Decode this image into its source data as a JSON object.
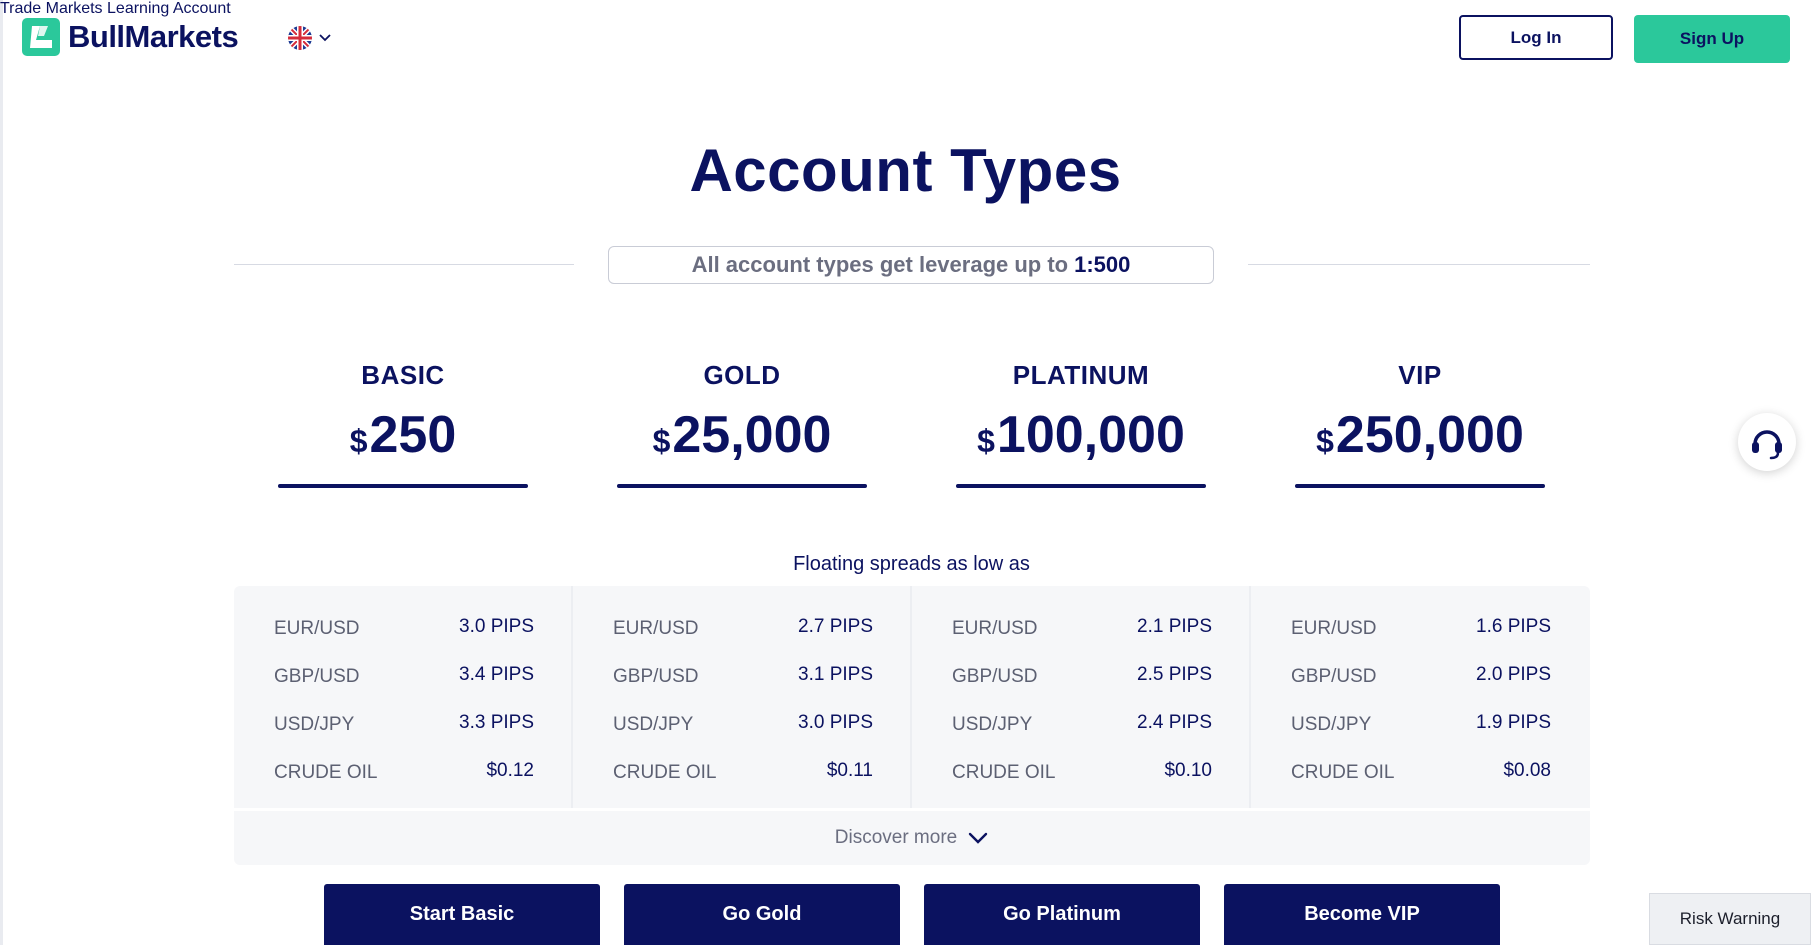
{
  "brand": {
    "name": "BullMarkets",
    "accent": "#2bc89b",
    "navy": "#0b1260"
  },
  "language": {
    "icon": "uk-flag-icon"
  },
  "nav": {
    "items": [
      {
        "label": "Trade"
      },
      {
        "label": "Markets"
      },
      {
        "label": "Learning"
      },
      {
        "label": "Account"
      }
    ],
    "login_label": "Log In",
    "signup_label": "Sign Up"
  },
  "page": {
    "title": "Account Types",
    "leverage_text": "All account types get leverage up to",
    "leverage_value": "1:500",
    "spread_caption": "Floating spreads as low as",
    "discover_label": "Discover more"
  },
  "plans": [
    {
      "name": "BASIC",
      "currency": "$",
      "amount": "250",
      "cta": "Start Basic",
      "spreads": [
        {
          "instrument": "EUR/USD",
          "value": "3.0 PIPS"
        },
        {
          "instrument": "GBP/USD",
          "value": "3.4 PIPS"
        },
        {
          "instrument": "USD/JPY",
          "value": "3.3 PIPS"
        },
        {
          "instrument": "CRUDE OIL",
          "value": "$0.12"
        }
      ]
    },
    {
      "name": "GOLD",
      "currency": "$",
      "amount": "25,000",
      "cta": "Go Gold",
      "spreads": [
        {
          "instrument": "EUR/USD",
          "value": "2.7 PIPS"
        },
        {
          "instrument": "GBP/USD",
          "value": "3.1 PIPS"
        },
        {
          "instrument": "USD/JPY",
          "value": "3.0 PIPS"
        },
        {
          "instrument": "CRUDE OIL",
          "value": "$0.11"
        }
      ]
    },
    {
      "name": "PLATINUM",
      "currency": "$",
      "amount": "100,000",
      "cta": "Go Platinum",
      "spreads": [
        {
          "instrument": "EUR/USD",
          "value": "2.1 PIPS"
        },
        {
          "instrument": "GBP/USD",
          "value": "2.5 PIPS"
        },
        {
          "instrument": "USD/JPY",
          "value": "2.4 PIPS"
        },
        {
          "instrument": "CRUDE OIL",
          "value": "$0.10"
        }
      ]
    },
    {
      "name": "VIP",
      "currency": "$",
      "amount": "250,000",
      "cta": "Become VIP",
      "spreads": [
        {
          "instrument": "EUR/USD",
          "value": "1.6 PIPS"
        },
        {
          "instrument": "GBP/USD",
          "value": "2.0 PIPS"
        },
        {
          "instrument": "USD/JPY",
          "value": "1.9 PIPS"
        },
        {
          "instrument": "CRUDE OIL",
          "value": "$0.08"
        }
      ]
    }
  ],
  "support": {
    "icon": "headset-icon"
  },
  "risk_warning": {
    "label": "Risk Warning"
  }
}
